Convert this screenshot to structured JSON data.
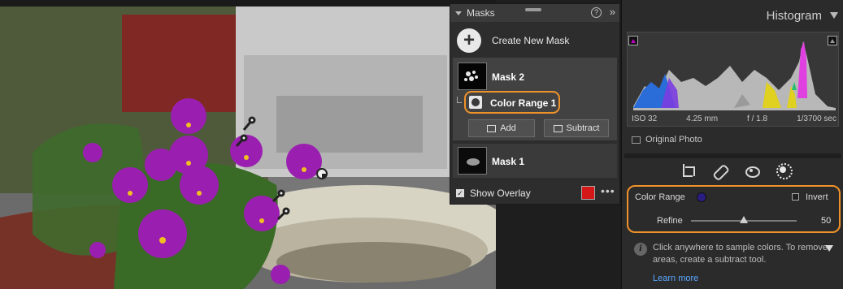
{
  "masks_panel": {
    "title": "Masks",
    "help_glyph": "?",
    "collapse_glyph": "»",
    "create_label": "Create New Mask",
    "mask2_label": "Mask 2",
    "color_range_label": "Color Range 1",
    "add_label": "Add",
    "subtract_label": "Subtract",
    "mask1_label": "Mask 1",
    "overlay_label": "Show Overlay",
    "overlay_checked_glyph": "✓",
    "overlay_color": "#d41818",
    "more_glyph": "•••"
  },
  "histogram": {
    "title": "Histogram",
    "iso": "ISO 32",
    "focal": "4.25 mm",
    "aperture": "f / 1.8",
    "shutter": "1/3700 sec",
    "original_photo_label": "Original Photo"
  },
  "color_range_panel": {
    "label": "Color Range",
    "sample_color": "#2a1e82",
    "invert_label": "Invert",
    "refine_label": "Refine",
    "refine_value": "50",
    "refine_fraction": 0.5
  },
  "hint": {
    "text": "Click anywhere to sample colors. To remove areas, create a subtract tool.",
    "learn_more": "Learn more"
  },
  "accent_color": "#f0922a"
}
